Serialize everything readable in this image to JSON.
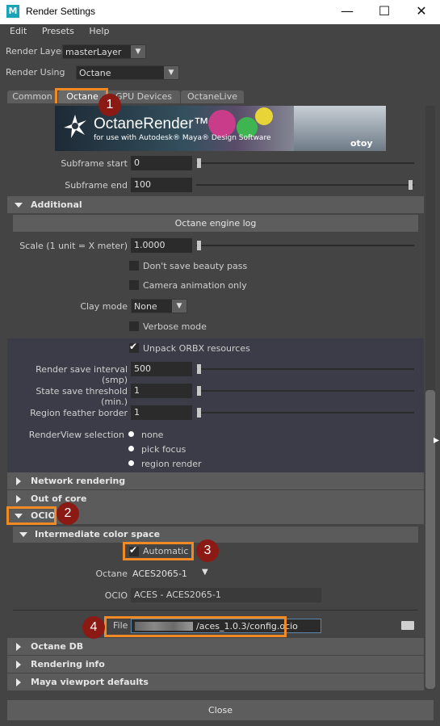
{
  "window": {
    "title": "Render Settings",
    "minimize": "—",
    "maximize": "☐",
    "close": "✕",
    "logo_letter": "M"
  },
  "menu": [
    "Edit",
    "Presets",
    "Help"
  ],
  "render_layer": {
    "label": "Render Layer",
    "value": "masterLayer"
  },
  "render_using": {
    "label": "Render Using",
    "value": "Octane"
  },
  "tabs": [
    "Common",
    "Octane",
    "GPU Devices",
    "OctaneLive"
  ],
  "banner": {
    "title": "OctaneRender™",
    "subtitle": "for use with Autodesk® Maya® Design Software",
    "brand": "otoy"
  },
  "subframe_start": {
    "label": "Subframe start",
    "value": "0"
  },
  "subframe_end": {
    "label": "Subframe end",
    "value": "100"
  },
  "additional": {
    "header": "Additional",
    "engine_log": "Octane engine log",
    "scale": {
      "label": "Scale (1 unit = X meter)",
      "value": "1.0000"
    },
    "dont_save_beauty": "Don't save beauty pass",
    "camera_anim_only": "Camera animation only",
    "clay_mode": {
      "label": "Clay mode",
      "value": "None"
    },
    "verbose_mode": "Verbose mode",
    "unpack_orbx": "Unpack ORBX resources",
    "render_save_interval": {
      "label": "Render save interval (smp)",
      "value": "500"
    },
    "state_save_threshold": {
      "label": "State save threshold (min.)",
      "value": "1"
    },
    "region_feather_border": {
      "label": "Region feather border",
      "value": "1"
    },
    "renderview_selection": {
      "label": "RenderView selection",
      "options": [
        "none",
        "pick focus",
        "region render"
      ]
    }
  },
  "sections": {
    "network": "Network rendering",
    "out_of_core": "Out of core",
    "ocio": "OCIO",
    "intermediate": "Intermediate color space",
    "octane_db": "Octane DB",
    "rendering_info": "Rendering info",
    "maya_viewport": "Maya viewport defaults"
  },
  "ocio": {
    "automatic": "Automatic",
    "octane_label": "Octane",
    "octane_value": "ACES2065-1",
    "ocio_label": "OCIO",
    "ocio_value": "ACES - ACES2065-1",
    "file_label": "File",
    "file_value": "/aces_1.0.3/config.ocio"
  },
  "annotations": [
    "1",
    "2",
    "3",
    "4"
  ],
  "close_button": "Close",
  "colors": {
    "highlight": "#f08a24",
    "badge": "#8b1a14"
  }
}
